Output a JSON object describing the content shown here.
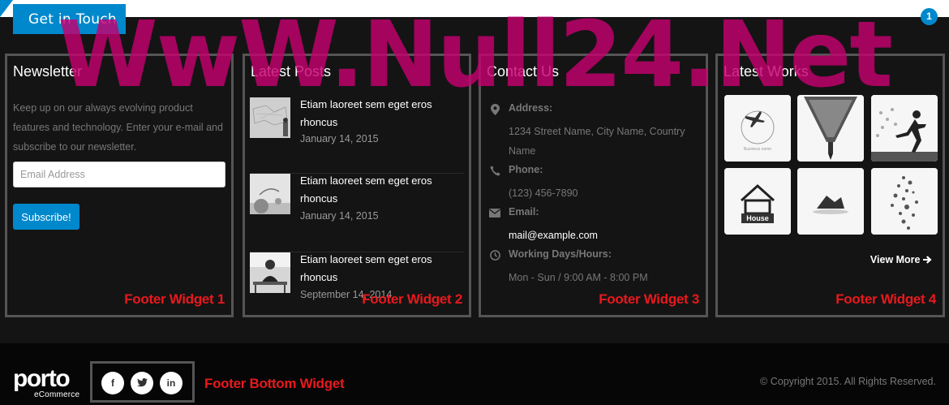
{
  "top": {
    "button_label": "Get in Touch",
    "badge": "1"
  },
  "widgets": {
    "newsletter": {
      "title": "Newsletter",
      "text": "Keep up on our always evolving product features and technology. Enter your e-mail and subscribe to our newsletter.",
      "email_placeholder": "Email Address",
      "subscribe_label": "Subscribe!",
      "tag": "Footer Widget 1"
    },
    "posts": {
      "title": "Latest Posts",
      "items": [
        {
          "title": "Etiam laoreet sem eget eros rhoncus",
          "date": "January 14, 2015"
        },
        {
          "title": "Etiam laoreet sem eget eros rhoncus",
          "date": "January 14, 2015"
        },
        {
          "title": "Etiam laoreet sem eget eros rhoncus",
          "date": "September 14, 2014"
        }
      ],
      "tag": "Footer Widget 2"
    },
    "contact": {
      "title": "Contact Us",
      "address_label": "Address:",
      "address_value": "1234 Street Name, City Name, Country Name",
      "phone_label": "Phone:",
      "phone_value": "(123) 456-7890",
      "email_label": "Email:",
      "email_value": "mail@example.com",
      "hours_label": "Working Days/Hours:",
      "hours_value": "Mon - Sun / 9:00 AM - 8:00 PM",
      "tag": "Footer Widget 3"
    },
    "works": {
      "title": "Latest Works",
      "view_more": "View More",
      "thumb_texts": {
        "business": "Business name",
        "house": "House"
      },
      "tag": "Footer Widget 4"
    }
  },
  "bottom": {
    "logo_word": "porto",
    "logo_sub": "eCommerce",
    "social": {
      "facebook": "f",
      "twitter": "t",
      "linkedin": "in"
    },
    "tag": "Footer Bottom Widget",
    "copyright": "© Copyright 2015. All Rights Reserved."
  },
  "watermark": "WwW.Null24.Net",
  "colors": {
    "accent": "#0088cc",
    "widget_tag": "#e8191d",
    "watermark": "#c4006f",
    "footer_bg": "#141414",
    "footer_bottom_bg": "#060606"
  }
}
